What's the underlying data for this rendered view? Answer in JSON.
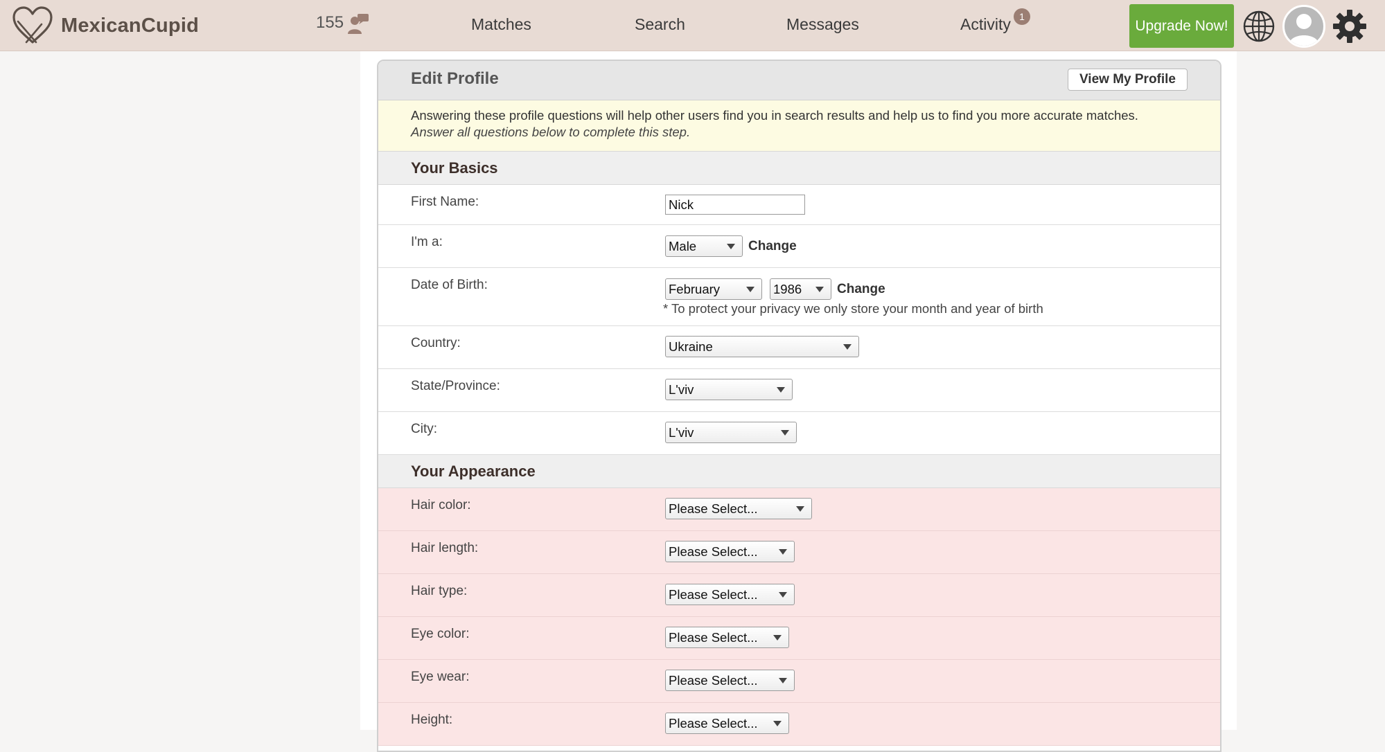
{
  "brand": {
    "name": "MexicanCupid",
    "colors": {
      "topbar": "#e8dbd4",
      "upgrade": "#6aab3c",
      "notice": "#fdfbe2",
      "required_row": "#fbe5e5"
    }
  },
  "nav": {
    "online_count": "155",
    "online_icon": "users-icon",
    "matches": "Matches",
    "search": "Search",
    "messages": "Messages",
    "activity": "Activity",
    "activity_badge": "1",
    "upgrade": "Upgrade Now!",
    "language_icon": "globe-icon",
    "settings_icon": "gear-icon"
  },
  "panel": {
    "title": "Edit Profile",
    "view_profile": "View My Profile",
    "notice_line1": "Answering these profile questions will help other users find you in search results and help us to find you more accurate matches.",
    "notice_line2": "Answer all questions below to complete this step."
  },
  "basics": {
    "heading": "Your Basics",
    "first_name_label": "First Name:",
    "first_name_value": "Nick",
    "gender_label": "I'm a:",
    "gender_value": "Male",
    "change": "Change",
    "dob_label": "Date of Birth:",
    "dob_month": "February",
    "dob_year": "1986",
    "dob_note": "* To protect your privacy we only store your month and year of birth",
    "country_label": "Country:",
    "country_value": "Ukraine",
    "state_label": "State/Province:",
    "state_value": "L'viv",
    "city_label": "City:",
    "city_value": "L'viv"
  },
  "appearance": {
    "heading": "Your Appearance",
    "placeholder": "Please Select...",
    "hair_color_label": "Hair color:",
    "hair_length_label": "Hair length:",
    "hair_type_label": "Hair type:",
    "eye_color_label": "Eye color:",
    "eye_wear_label": "Eye wear:",
    "height_label": "Height:"
  }
}
